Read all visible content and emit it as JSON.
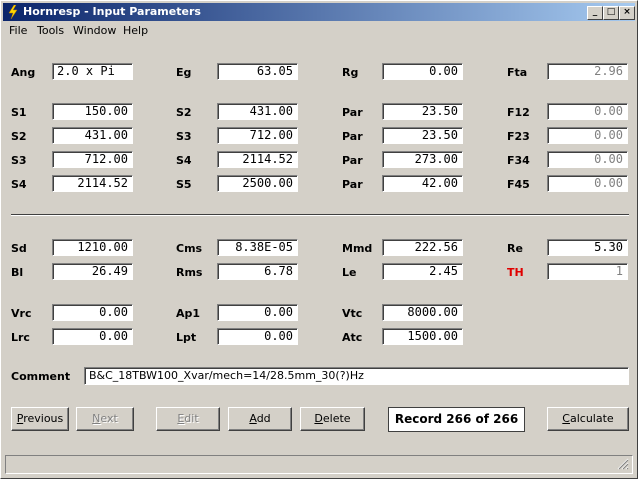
{
  "window": {
    "title": "Hornresp - Input Parameters",
    "controls": [
      "_",
      "□",
      "×"
    ]
  },
  "menu": [
    "File",
    "Tools",
    "Window",
    "Help"
  ],
  "params": {
    "ang": {
      "label": "Ang",
      "value": "2.0 x Pi"
    },
    "eg": {
      "label": "Eg",
      "value": "63.05"
    },
    "rg": {
      "label": "Rg",
      "value": "0.00"
    },
    "fta": {
      "label": "Fta",
      "value": "2.96"
    },
    "s1": {
      "label": "S1",
      "value": "150.00"
    },
    "s2a": {
      "label": "S2",
      "value": "431.00"
    },
    "par1": {
      "label": "Par",
      "value": "23.50"
    },
    "f12": {
      "label": "F12",
      "value": "0.00"
    },
    "s2b": {
      "label": "S2",
      "value": "431.00"
    },
    "s3a": {
      "label": "S3",
      "value": "712.00"
    },
    "par2": {
      "label": "Par",
      "value": "23.50"
    },
    "f23": {
      "label": "F23",
      "value": "0.00"
    },
    "s3b": {
      "label": "S3",
      "value": "712.00"
    },
    "s4a": {
      "label": "S4",
      "value": "2114.52"
    },
    "par3": {
      "label": "Par",
      "value": "273.00"
    },
    "f34": {
      "label": "F34",
      "value": "0.00"
    },
    "s4b": {
      "label": "S4",
      "value": "2114.52"
    },
    "s5": {
      "label": "S5",
      "value": "2500.00"
    },
    "par4": {
      "label": "Par",
      "value": "42.00"
    },
    "f45": {
      "label": "F45",
      "value": "0.00"
    },
    "sd": {
      "label": "Sd",
      "value": "1210.00"
    },
    "cms": {
      "label": "Cms",
      "value": "8.38E-05"
    },
    "mmd": {
      "label": "Mmd",
      "value": "222.56"
    },
    "re": {
      "label": "Re",
      "value": "5.30"
    },
    "bl": {
      "label": "Bl",
      "value": "26.49"
    },
    "rms": {
      "label": "Rms",
      "value": "6.78"
    },
    "le": {
      "label": "Le",
      "value": "2.45"
    },
    "th": {
      "label": "TH",
      "value": "1"
    },
    "vrc": {
      "label": "Vrc",
      "value": "0.00"
    },
    "ap1": {
      "label": "Ap1",
      "value": "0.00"
    },
    "vtc": {
      "label": "Vtc",
      "value": "8000.00"
    },
    "lrc": {
      "label": "Lrc",
      "value": "0.00"
    },
    "lpt": {
      "label": "Lpt",
      "value": "0.00"
    },
    "atc": {
      "label": "Atc",
      "value": "1500.00"
    }
  },
  "comment": {
    "label": "Comment",
    "value": "B&C_18TBW100_Xvar/mech=14/28.5mm_30(?)Hz"
  },
  "buttons": {
    "previous": {
      "pre": "",
      "u": "P",
      "post": "revious"
    },
    "next": {
      "pre": "",
      "u": "N",
      "post": "ext"
    },
    "edit": {
      "pre": "",
      "u": "E",
      "post": "dit"
    },
    "add": {
      "pre": "",
      "u": "A",
      "post": "dd"
    },
    "delete": {
      "pre": "",
      "u": "D",
      "post": "elete"
    },
    "calculate": {
      "pre": "",
      "u": "C",
      "post": "alculate"
    }
  },
  "record": "Record 266 of 266",
  "colors": {
    "title_start": "#0a246a",
    "title_end": "#a6caf0",
    "th_label": "#e00000",
    "face": "#d4d0c8"
  }
}
